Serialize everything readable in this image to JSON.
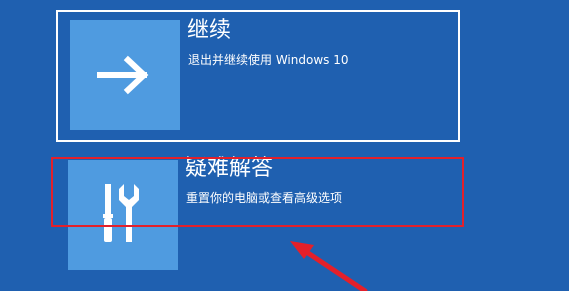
{
  "options": [
    {
      "title": "继续",
      "description": "退出并继续使用 Windows 10",
      "icon": "arrow-right-icon",
      "selected": true
    },
    {
      "title": "疑难解答",
      "description": "重置你的电脑或查看高级选项",
      "icon": "tools-icon",
      "highlighted": true
    }
  ],
  "colors": {
    "background": "#1f60b0",
    "tile": "#4f9be0",
    "focus_border": "#ffffff",
    "annotation": "#e4202a"
  }
}
